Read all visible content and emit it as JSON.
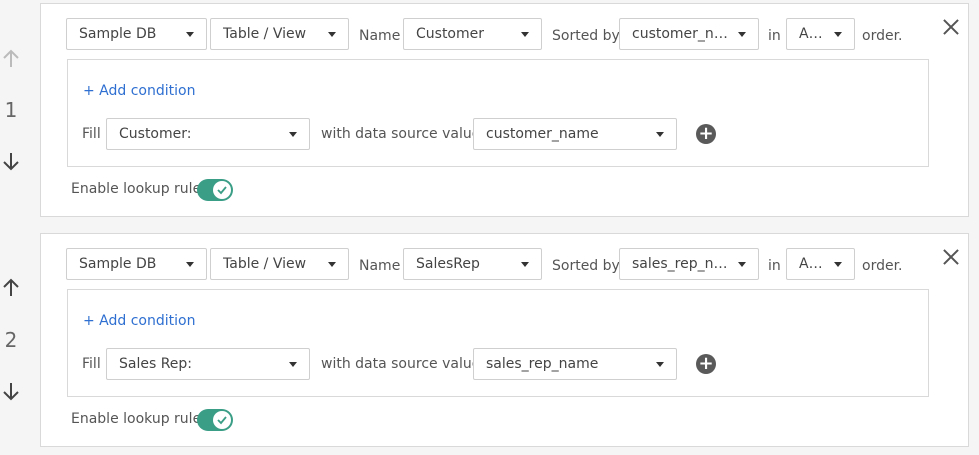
{
  "rules": [
    {
      "number": "1",
      "database": "Sample DB",
      "object_type": "Table / View",
      "name_label": "Name",
      "name_value": "Customer",
      "sorted_by_label": "Sorted by",
      "sorted_by_value": "customer_na...",
      "in_label": "in",
      "order_value": "Asc...",
      "order_label": "order.",
      "add_condition": "+ Add condition",
      "fill_label": "Fill",
      "fill_field": "Customer:",
      "with_label": "with data source value",
      "source_value": "customer_name",
      "enable_label": "Enable lookup rule",
      "enabled": true
    },
    {
      "number": "2",
      "database": "Sample DB",
      "object_type": "Table / View",
      "name_label": "Name",
      "name_value": "SalesRep",
      "sorted_by_label": "Sorted by",
      "sorted_by_value": "sales_rep_na...",
      "in_label": "in",
      "order_value": "Asc...",
      "order_label": "order.",
      "add_condition": "+ Add condition",
      "fill_label": "Fill",
      "fill_field": "Sales Rep:",
      "with_label": "with data source value",
      "source_value": "sales_rep_name",
      "enable_label": "Enable lookup rule",
      "enabled": true
    }
  ],
  "colors": {
    "link": "#2e6fd1",
    "toggle_on": "#3a9e86",
    "border": "#d9d9d9"
  },
  "icons": [
    "arrow-up-icon",
    "arrow-down-icon",
    "close-icon",
    "caret-down-icon",
    "plus-circle-icon",
    "check-icon"
  ]
}
